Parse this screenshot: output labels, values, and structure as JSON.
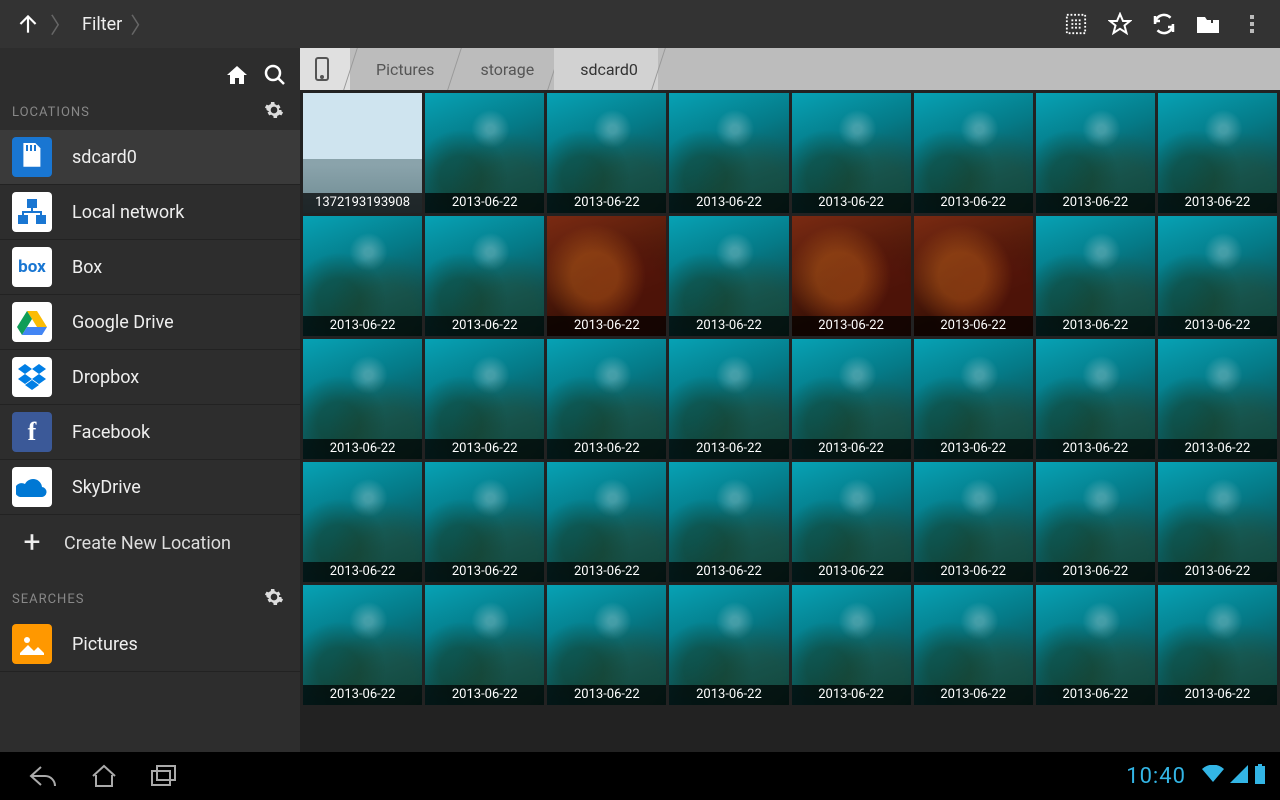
{
  "topbar": {
    "title": "Filter"
  },
  "sidebar": {
    "locations_label": "LOCATIONS",
    "searches_label": "SEARCHES",
    "new_location_label": "Create New Location",
    "locations": [
      {
        "label": "sdcard0",
        "kind": "sdcard",
        "selected": true
      },
      {
        "label": "Local network",
        "kind": "network",
        "selected": false
      },
      {
        "label": "Box",
        "kind": "box",
        "selected": false
      },
      {
        "label": "Google Drive",
        "kind": "gdrive",
        "selected": false
      },
      {
        "label": "Dropbox",
        "kind": "dropbox",
        "selected": false
      },
      {
        "label": "Facebook",
        "kind": "facebook",
        "selected": false
      },
      {
        "label": "SkyDrive",
        "kind": "skydrive",
        "selected": false
      }
    ],
    "searches": [
      {
        "label": "Pictures",
        "kind": "pictures"
      }
    ]
  },
  "breadcrumb": [
    "Pictures",
    "storage",
    "sdcard0"
  ],
  "grid_cols": 8,
  "thumbnails": [
    {
      "caption": "1372193193908",
      "style": "sky"
    },
    {
      "caption": "2013-06-22",
      "style": "aqua"
    },
    {
      "caption": "2013-06-22",
      "style": "aqua"
    },
    {
      "caption": "2013-06-22",
      "style": "aqua"
    },
    {
      "caption": "2013-06-22",
      "style": "aqua"
    },
    {
      "caption": "2013-06-22",
      "style": "aqua"
    },
    {
      "caption": "2013-06-22",
      "style": "aqua"
    },
    {
      "caption": "2013-06-22",
      "style": "aqua"
    },
    {
      "caption": "2013-06-22",
      "style": "aqua"
    },
    {
      "caption": "2013-06-22",
      "style": "aqua"
    },
    {
      "caption": "2013-06-22",
      "style": "warm"
    },
    {
      "caption": "2013-06-22",
      "style": "aqua"
    },
    {
      "caption": "2013-06-22",
      "style": "warm"
    },
    {
      "caption": "2013-06-22",
      "style": "warm"
    },
    {
      "caption": "2013-06-22",
      "style": "aqua"
    },
    {
      "caption": "2013-06-22",
      "style": "aqua"
    },
    {
      "caption": "2013-06-22",
      "style": "aqua"
    },
    {
      "caption": "2013-06-22",
      "style": "aqua"
    },
    {
      "caption": "2013-06-22",
      "style": "aqua"
    },
    {
      "caption": "2013-06-22",
      "style": "aqua"
    },
    {
      "caption": "2013-06-22",
      "style": "aqua"
    },
    {
      "caption": "2013-06-22",
      "style": "aqua"
    },
    {
      "caption": "2013-06-22",
      "style": "aqua"
    },
    {
      "caption": "2013-06-22",
      "style": "aqua"
    },
    {
      "caption": "2013-06-22",
      "style": "aqua"
    },
    {
      "caption": "2013-06-22",
      "style": "aqua"
    },
    {
      "caption": "2013-06-22",
      "style": "aqua"
    },
    {
      "caption": "2013-06-22",
      "style": "aqua"
    },
    {
      "caption": "2013-06-22",
      "style": "aqua"
    },
    {
      "caption": "2013-06-22",
      "style": "aqua"
    },
    {
      "caption": "2013-06-22",
      "style": "aqua"
    },
    {
      "caption": "2013-06-22",
      "style": "aqua"
    },
    {
      "caption": "2013-06-22",
      "style": "aqua"
    },
    {
      "caption": "2013-06-22",
      "style": "aqua"
    },
    {
      "caption": "2013-06-22",
      "style": "aqua"
    },
    {
      "caption": "2013-06-22",
      "style": "aqua"
    },
    {
      "caption": "2013-06-22",
      "style": "aqua"
    },
    {
      "caption": "2013-06-22",
      "style": "aqua"
    },
    {
      "caption": "2013-06-22",
      "style": "aqua"
    },
    {
      "caption": "2013-06-22",
      "style": "aqua"
    }
  ],
  "statusbar": {
    "time": "10:40"
  }
}
